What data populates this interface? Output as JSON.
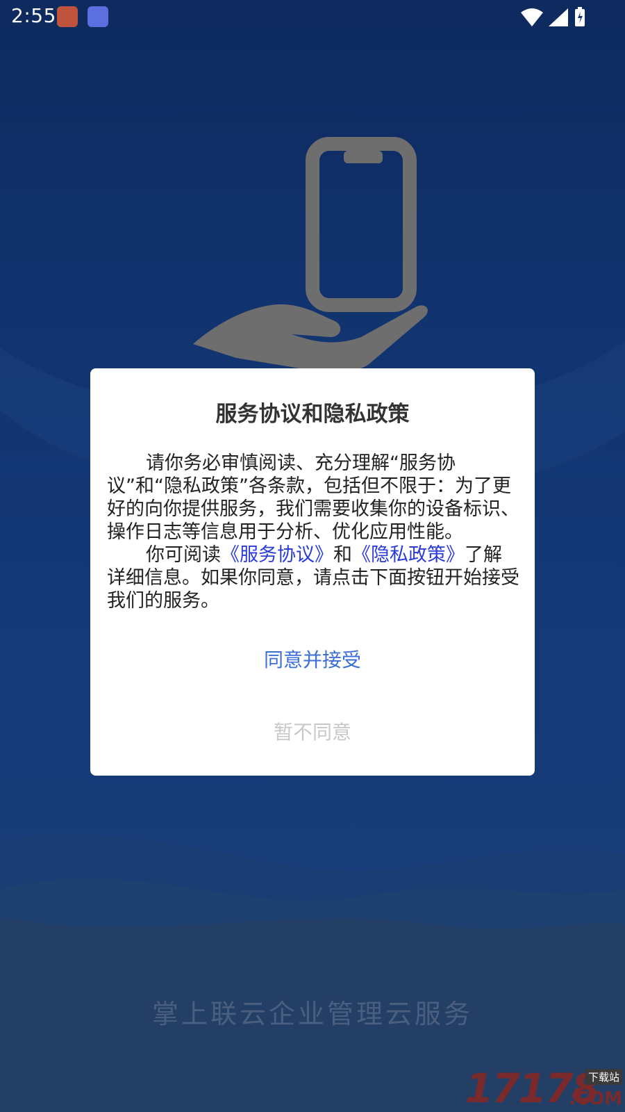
{
  "status_bar": {
    "time": "2:55"
  },
  "dialog": {
    "title": "服务协议和隐私政策",
    "paragraph1": "请你务必审慎阅读、充分理解“服务协议”和“隐私政策”各条款，包括但不限于：为了更好的向你提供服务，我们需要收集你的设备标识、操作日志等信息用于分析、优化应用性能。",
    "paragraph2_prefix": "你可阅读",
    "service_agreement_link": "《服务协议》",
    "paragraph2_and": "和",
    "privacy_policy_link": "《隐私政策》",
    "paragraph2_suffix": "了解详细信息。如果你同意，请点击下面按钮开始接受我们的服务。",
    "agree_label": "同意并接受",
    "disagree_label": "暂不同意"
  },
  "footer": {
    "slogan": "掌上联云企业管理云服务"
  },
  "watermark": {
    "number": "17178",
    "suffix": ".COM",
    "tag": "下载站"
  },
  "colors": {
    "background": "#123572",
    "link": "#2a3cd8",
    "agree": "#3b6fd6",
    "disagree": "#c8c8c8"
  }
}
